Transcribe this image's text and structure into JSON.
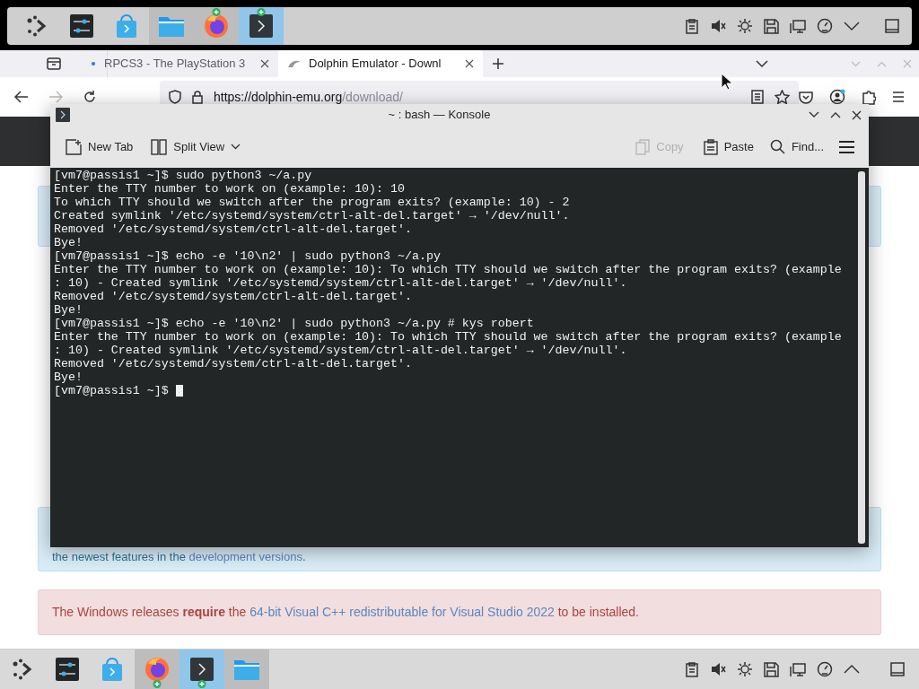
{
  "top_panel": {
    "tasks": [
      {
        "kind": "launcher",
        "open": false,
        "selected": false,
        "badge": false
      },
      {
        "kind": "settings",
        "open": false,
        "selected": false,
        "badge": false
      },
      {
        "kind": "discover",
        "open": false,
        "selected": false,
        "badge": false
      },
      {
        "kind": "files",
        "open": true,
        "selected": false,
        "badge": false
      },
      {
        "kind": "firefox",
        "open": true,
        "selected": false,
        "badge": true
      },
      {
        "kind": "terminal",
        "open": true,
        "selected": true,
        "badge": true
      }
    ]
  },
  "browser": {
    "tabs": [
      {
        "title": "RPCS3 - The PlayStation 3",
        "selected": false
      },
      {
        "title": "Dolphin Emulator - Downl",
        "selected": true
      }
    ],
    "url_domain": "https://dolphin-emu.org",
    "url_path": "/download/"
  },
  "page": {
    "note": {
      "text": "the newest features in the ",
      "link": "development versions",
      "after": "."
    },
    "alert": {
      "text": "The Windows releases **require** the ",
      "link": "64-bit Visual C++ redistributable for Visual Studio 2022",
      "after": " to be installed."
    }
  },
  "konsole": {
    "title": "~ : bash — Konsole",
    "toolbar": [
      {
        "label": "New Tab",
        "kind": "new-tab",
        "disabled": false
      },
      {
        "label": "Split View",
        "kind": "split",
        "disabled": false
      },
      {
        "label": "Copy",
        "kind": "copy",
        "disabled": true
      },
      {
        "label": "Paste",
        "kind": "paste",
        "disabled": false
      },
      {
        "label": "Find...",
        "kind": "find",
        "disabled": false
      }
    ],
    "lines": [
      "[vm7@passis1 ~]$ sudo python3 ~/a.py",
      "Enter the TTY number to work on (example: 10): 10",
      "To which TTY should we switch after the program exits? (example: 10) - 2",
      "Created symlink '/etc/systemd/system/ctrl-alt-del.target' → '/dev/null'.",
      "Removed '/etc/systemd/system/ctrl-alt-del.target'.",
      "Bye!",
      "[vm7@passis1 ~]$ echo -e '10\\n2' | sudo python3 ~/a.py",
      "Enter the TTY number to work on (example: 10): To which TTY should we switch after the program exits? (example",
      ": 10) - Created symlink '/etc/systemd/system/ctrl-alt-del.target' → '/dev/null'.",
      "Removed '/etc/systemd/system/ctrl-alt-del.target'.",
      "Bye!",
      "[vm7@passis1 ~]$ echo -e '10\\n2' | sudo python3 ~/a.py # kys robert",
      "Enter the TTY number to work on (example: 10): To which TTY should we switch after the program exits? (example",
      ": 10) - Created symlink '/etc/systemd/system/ctrl-alt-del.target' → '/dev/null'.",
      "Removed '/etc/systemd/system/ctrl-alt-del.target'.",
      "Bye!",
      "[vm7@passis1 ~]$ "
    ]
  },
  "bottom_panel": {
    "tasks": [
      {
        "kind": "launcher",
        "open": false,
        "selected": false,
        "badge": false
      },
      {
        "kind": "settings",
        "open": false,
        "selected": false,
        "badge": false
      },
      {
        "kind": "discover",
        "open": false,
        "selected": false,
        "badge": false
      },
      {
        "kind": "firefox",
        "open": true,
        "selected": false,
        "badge": true
      },
      {
        "kind": "terminal",
        "open": true,
        "selected": true,
        "badge": true
      },
      {
        "kind": "files",
        "open": true,
        "selected": false,
        "badge": false
      }
    ]
  }
}
